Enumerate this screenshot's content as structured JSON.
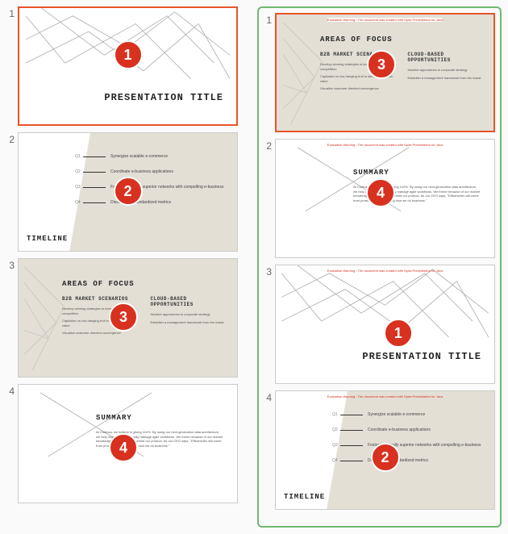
{
  "left": {
    "slides": [
      {
        "num": "1",
        "badge": "1",
        "type": "title"
      },
      {
        "num": "2",
        "badge": "2",
        "type": "timeline"
      },
      {
        "num": "3",
        "badge": "3",
        "type": "areas"
      },
      {
        "num": "4",
        "badge": "4",
        "type": "summary"
      }
    ]
  },
  "right": {
    "slides": [
      {
        "num": "1",
        "badge": "3",
        "type": "areas",
        "selected": true,
        "warning": true
      },
      {
        "num": "2",
        "badge": "4",
        "type": "summary",
        "warning": true
      },
      {
        "num": "3",
        "badge": "1",
        "type": "title",
        "warning": true
      },
      {
        "num": "4",
        "badge": "2",
        "type": "timeline",
        "warning": true
      }
    ]
  },
  "content": {
    "title": "PRESENTATION TITLE",
    "timeline": {
      "label": "TIMELINE",
      "items": [
        {
          "q": "Q1",
          "text": "Synergize scalable e-commerce"
        },
        {
          "q": "Q2",
          "text": "Coordinate e-business applications"
        },
        {
          "q": "Q3",
          "text": "Foster holistically superior networks with compelling e-business"
        },
        {
          "q": "Q4",
          "text": "Disseminate standardized metrics"
        }
      ]
    },
    "areas": {
      "heading": "AREAS OF FOCUS",
      "col1": {
        "title": "B2B MARKET SCENARIOS",
        "lines": [
          "Develop winning strategies to keep ahead of the competition",
          "Capitalize on low-hanging fruit to identify a ballpark value",
          "Visualize customer directed convergence"
        ]
      },
      "col2": {
        "title": "CLOUD-BASED OPPORTUNITIES",
        "lines": [
          "Iterative approaches to corporate strategy",
          "Establish a management framework from the inside"
        ]
      }
    },
    "summary": {
      "heading": "SUMMARY",
      "body": "At Contoso, we believe in giving 110%. By using our next-generation data architecture, we help organizations virtually manage agile workflows. We thrive because of our market knowledge and great team behind our product. As our CEO says, \"Efficiencies will come from proactively transforming how we do business.\""
    },
    "warning": "Evaluation Warning : The document was created with Spire.Presentation for Java"
  }
}
